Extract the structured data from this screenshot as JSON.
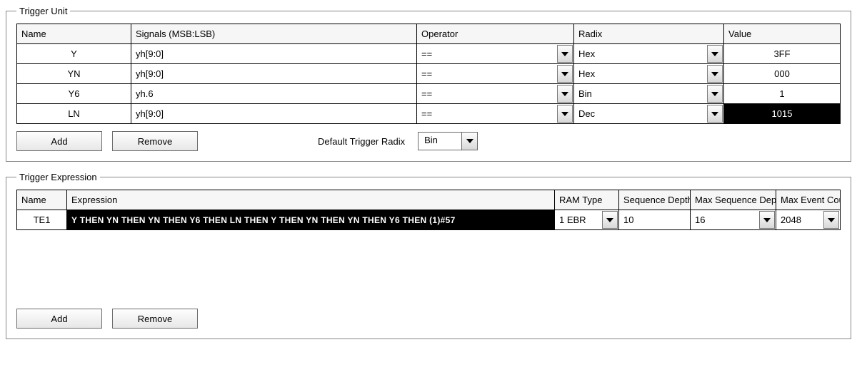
{
  "trigger_unit": {
    "legend": "Trigger Unit",
    "headers": {
      "name": "Name",
      "signals": "Signals (MSB:LSB)",
      "operator": "Operator",
      "radix": "Radix",
      "value": "Value"
    },
    "rows": [
      {
        "name": "Y",
        "signals": "yh[9:0]",
        "operator": "==",
        "radix": "Hex",
        "value": "3FF",
        "value_inverted": false
      },
      {
        "name": "YN",
        "signals": "yh[9:0]",
        "operator": "==",
        "radix": "Hex",
        "value": "000",
        "value_inverted": false
      },
      {
        "name": "Y6",
        "signals": "yh.6",
        "operator": "==",
        "radix": "Bin",
        "value": "1",
        "value_inverted": false
      },
      {
        "name": "LN",
        "signals": "yh[9:0]",
        "operator": "==",
        "radix": "Dec",
        "value": "1015",
        "value_inverted": true
      }
    ],
    "buttons": {
      "add": "Add",
      "remove": "Remove"
    },
    "default_radix_label": "Default Trigger Radix",
    "default_radix_value": "Bin"
  },
  "trigger_expression": {
    "legend": "Trigger Expression",
    "headers": {
      "name": "Name",
      "expression": "Expression",
      "ram_type": "RAM Type",
      "seq_depth": "Sequence Depth",
      "max_seq_depth": "Max Sequence Depth",
      "max_event_counter": "Max Event Counter"
    },
    "rows": [
      {
        "name": "TE1",
        "expression": "Y THEN YN THEN YN THEN Y6 THEN LN THEN Y THEN YN THEN YN THEN Y6 THEN (1)#57",
        "ram_type": "1 EBR",
        "seq_depth": "10",
        "max_seq_depth": "16",
        "max_event_counter": "2048"
      }
    ],
    "buttons": {
      "add": "Add",
      "remove": "Remove"
    }
  }
}
